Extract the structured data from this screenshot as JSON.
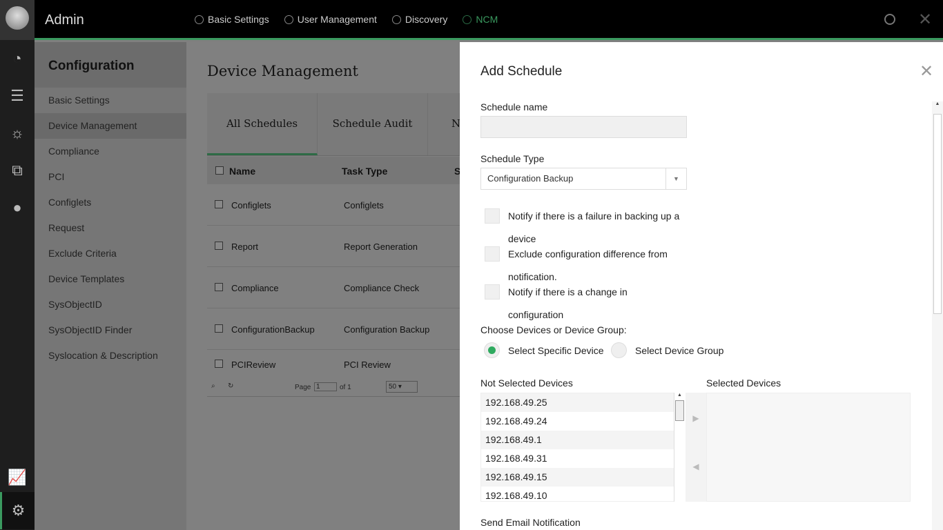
{
  "header": {
    "title": "Admin",
    "nav": [
      {
        "label": "Basic Settings"
      },
      {
        "label": "User Management"
      },
      {
        "label": "Discovery"
      },
      {
        "label": "NCM"
      }
    ]
  },
  "sidebar": {
    "title": "Configuration",
    "items": [
      {
        "label": "Basic Settings"
      },
      {
        "label": "Device Management"
      },
      {
        "label": "Compliance"
      },
      {
        "label": "PCI"
      },
      {
        "label": "Configlets"
      },
      {
        "label": "Request"
      },
      {
        "label": "Exclude Criteria"
      },
      {
        "label": "Device Templates"
      },
      {
        "label": "SysObjectID"
      },
      {
        "label": "SysObjectID Finder"
      },
      {
        "label": "Syslocation & Description"
      }
    ]
  },
  "main": {
    "title": "Device Management",
    "tabs": [
      {
        "label": "All Schedules"
      },
      {
        "label": "Schedule Audit"
      },
      {
        "label": "N"
      }
    ],
    "columns": {
      "name": "Name",
      "task": "Task Type",
      "s": "S"
    },
    "rows": [
      {
        "name": "Configlets",
        "task": "Configlets"
      },
      {
        "name": "Report",
        "task": "Report Generation"
      },
      {
        "name": "Compliance",
        "task": "Compliance Check"
      },
      {
        "name": "ConfigurationBackup",
        "task": "Configuration Backup"
      },
      {
        "name": "PCIReview",
        "task": "PCI Review"
      }
    ],
    "pager": {
      "page_label": "Page",
      "page": "1",
      "of": "of 1",
      "per_page": "50"
    }
  },
  "panel": {
    "title": "Add Schedule",
    "name_label": "Schedule name",
    "name_value": "",
    "type_label": "Schedule Type",
    "type_value": "Configuration Backup",
    "checks": [
      {
        "label": "Notify if there is a failure in backing up a device"
      },
      {
        "label": "Exclude configuration difference from notification."
      },
      {
        "label": "Notify if there is a change in configuration"
      }
    ],
    "choose_label": "Choose Devices or Device Group:",
    "radio_specific": "Select Specific Device",
    "radio_group": "Select Device Group",
    "not_selected_label": "Not Selected Devices",
    "selected_label": "Selected Devices",
    "devices": [
      "192.168.49.25",
      "192.168.49.24",
      "192.168.49.1",
      "192.168.49.31",
      "192.168.49.15",
      "192.168.49.10"
    ],
    "email_label": "Send Email Notification"
  }
}
